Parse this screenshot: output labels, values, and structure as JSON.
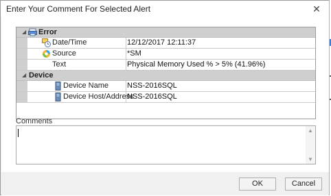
{
  "dialog": {
    "title": "Enter Your Comment For Selected Alert",
    "close_icon": "close-icon"
  },
  "grid": {
    "categories": [
      {
        "label": "Error",
        "icon": "printer-error-icon",
        "expanded": true,
        "rows": [
          {
            "name": "Date/Time",
            "value": "12/12/2017 12:11:37",
            "icon": "calendar-clock-icon"
          },
          {
            "name": "Source",
            "value": "*SM",
            "icon": "source-ring-icon"
          },
          {
            "name": "Text",
            "value": "Physical Memory Used % > 5% (41.96%)",
            "icon": ""
          }
        ]
      },
      {
        "label": "Device",
        "expanded": true,
        "rows": [
          {
            "name": "Device Name",
            "value": "NSS-2016SQL",
            "icon": "server-icon"
          },
          {
            "name": "Device Host/Address",
            "value": "NSS-2016SQL",
            "icon": "server-icon"
          }
        ]
      }
    ]
  },
  "comments": {
    "label": "Comments",
    "value": ""
  },
  "buttons": {
    "ok": "OK",
    "cancel": "Cancel"
  },
  "colors": {
    "category_bg": "#cfcfcf",
    "grid_border": "#9b9b9b",
    "dialog_bg": "#f0f0f0"
  }
}
